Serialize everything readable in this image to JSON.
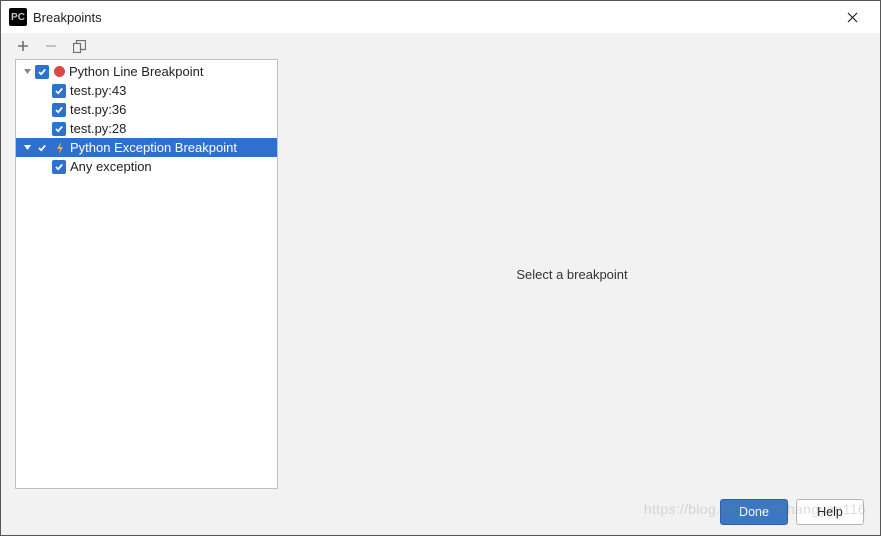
{
  "window": {
    "title": "Breakpoints",
    "icon_label": "PC"
  },
  "toolbar": {
    "add_tooltip": "Add",
    "remove_tooltip": "Remove",
    "group_tooltip": "Group"
  },
  "tree": {
    "groups": [
      {
        "label": "Python Line Breakpoint",
        "checked": true,
        "expanded": true,
        "icon": "breakpoint-dot",
        "selected": false,
        "items": [
          {
            "label": "test.py:43",
            "checked": true
          },
          {
            "label": "test.py:36",
            "checked": true
          },
          {
            "label": "test.py:28",
            "checked": true
          }
        ]
      },
      {
        "label": "Python Exception Breakpoint",
        "checked": true,
        "expanded": true,
        "icon": "exception",
        "selected": true,
        "items": [
          {
            "label": "Any exception",
            "checked": true
          }
        ]
      }
    ]
  },
  "details": {
    "placeholder": "Select a breakpoint"
  },
  "buttons": {
    "done": "Done",
    "help": "Help"
  },
  "watermark": "https://blog.csdn.net/changyan116"
}
